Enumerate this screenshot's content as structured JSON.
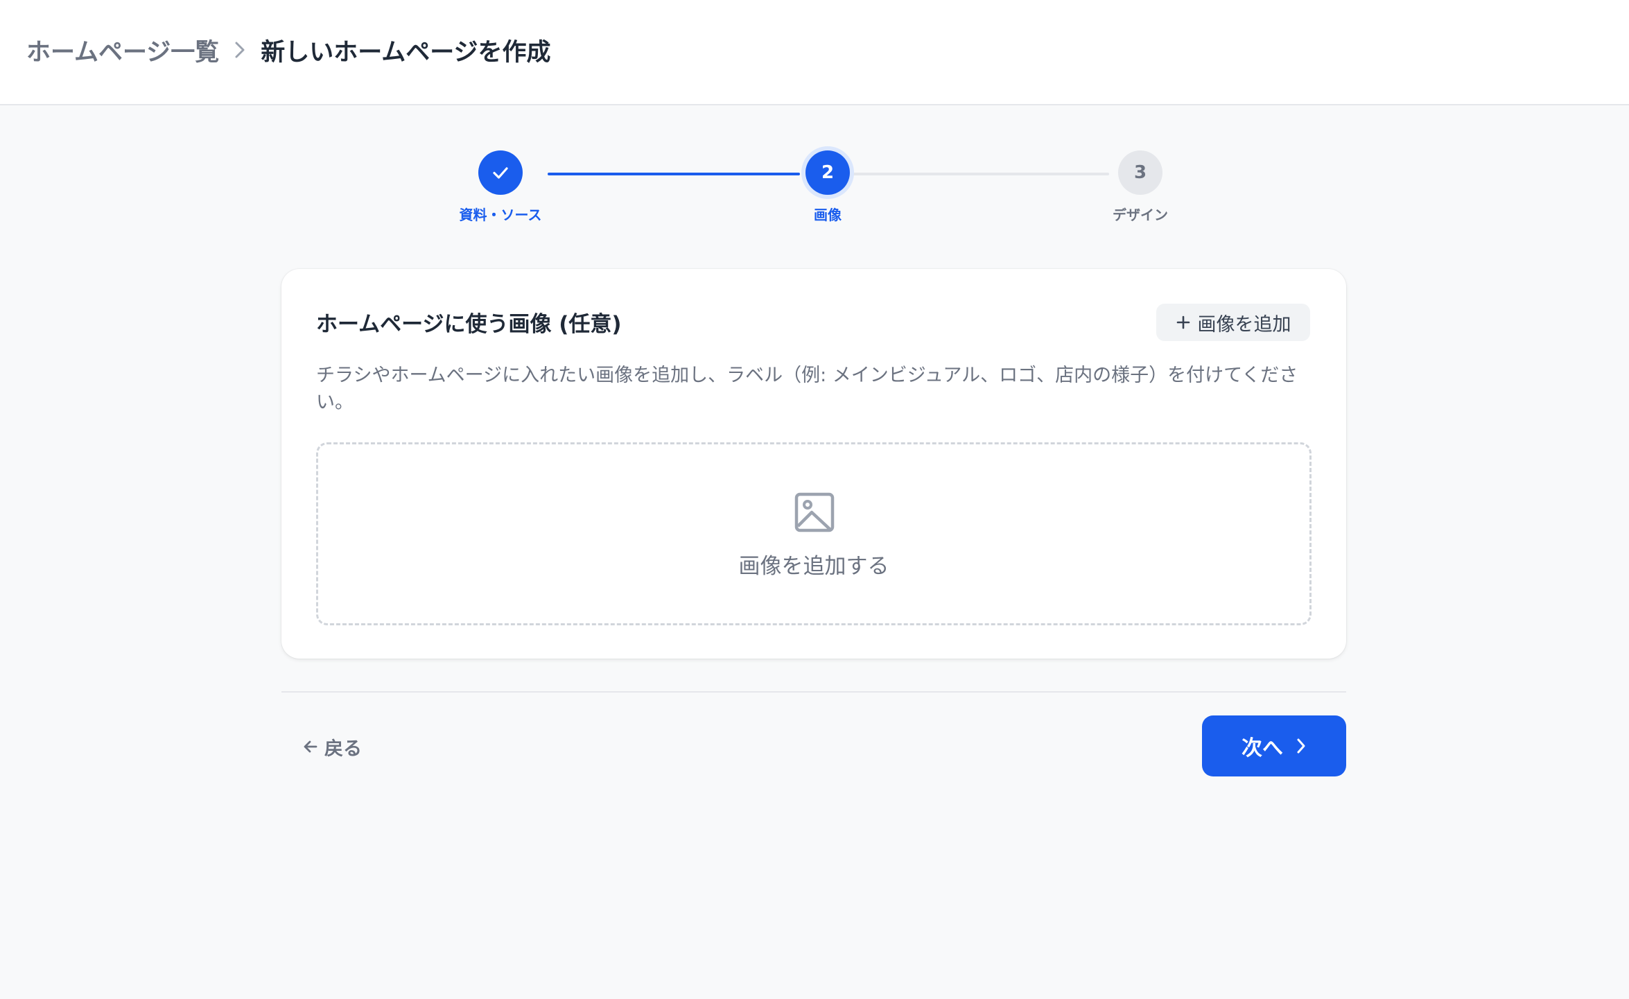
{
  "header": {
    "breadcrumb_parent": "ホームページ一覧",
    "breadcrumb_current": "新しいホームページを作成"
  },
  "stepper": {
    "steps": [
      {
        "label": "資料・ソース",
        "state": "completed"
      },
      {
        "number": "2",
        "label": "画像",
        "state": "current"
      },
      {
        "number": "3",
        "label": "デザイン",
        "state": "upcoming"
      }
    ]
  },
  "card": {
    "title": "ホームページに使う画像 (任意)",
    "add_button_label": "画像を追加",
    "description": "チラシやホームページに入れたい画像を追加し、ラベル（例: メインビジュアル、ロゴ、店内の様子）を付けてください。",
    "dropzone_label": "画像を追加する"
  },
  "footer": {
    "back_label": "戻る",
    "next_label": "次へ"
  },
  "colors": {
    "accent": "#1a5ded",
    "muted_text": "#6b7280",
    "dark_text": "#1f2937",
    "background": "#f8f9fa"
  }
}
